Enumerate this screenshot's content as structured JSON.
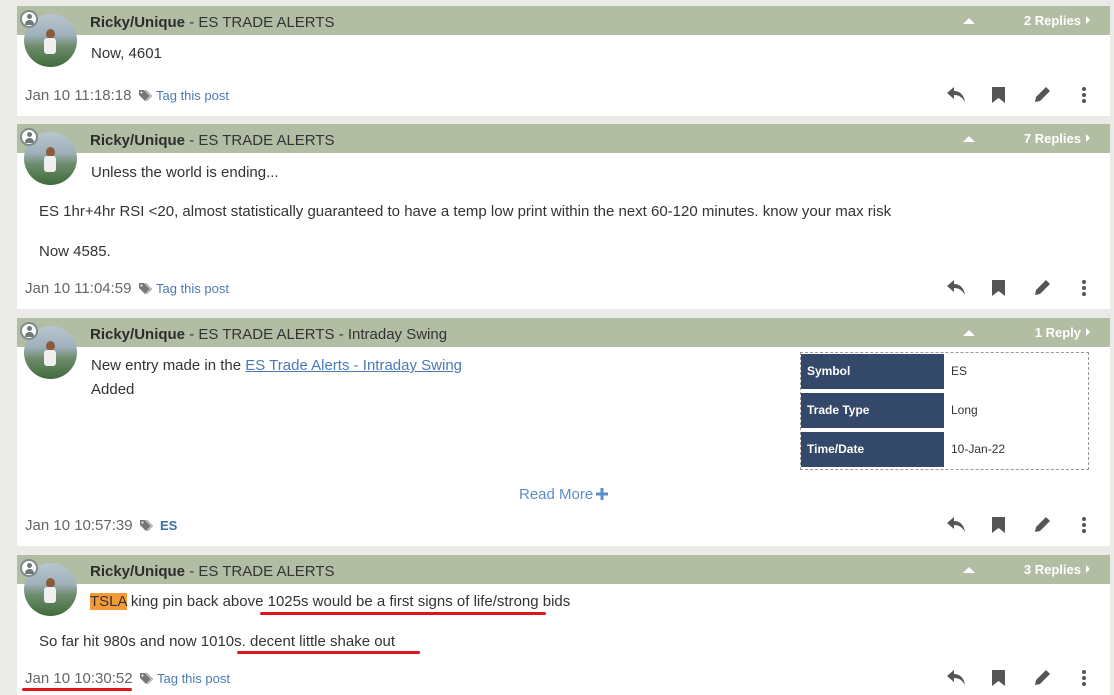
{
  "posts": [
    {
      "author": "Ricky/Unique",
      "channel": " - ES TRADE ALERTS",
      "replies": "2 Replies",
      "lines": [
        "Now, 4601"
      ],
      "time": "Jan 10 11:18:18",
      "tag": "Tag this post"
    },
    {
      "author": "Ricky/Unique",
      "channel": " - ES TRADE ALERTS",
      "replies": "7 Replies",
      "lines": [
        "Unless the world is ending...",
        "ES 1hr+4hr RSI <20, almost statistically guaranteed to have a temp low print within the next 60-120 minutes. know your max risk",
        "Now 4585."
      ],
      "time": "Jan 10 11:04:59",
      "tag": "Tag this post"
    },
    {
      "author": "Ricky/Unique",
      "channel": " - ES TRADE ALERTS - Intraday Swing",
      "replies": "1 Reply",
      "entry_prefix": "New entry made in the ",
      "entry_link": "ES Trade Alerts - Intraday Swing",
      "added": "Added",
      "trade_table": [
        {
          "key": "Symbol",
          "value": "ES"
        },
        {
          "key": "Trade Type",
          "value": "Long"
        },
        {
          "key": "Time/Date",
          "value": "10-Jan-22"
        }
      ],
      "read_more": "Read More",
      "time": "Jan 10 10:57:39",
      "tag": "ES"
    },
    {
      "author": "Ricky/Unique",
      "channel": " - ES TRADE ALERTS",
      "replies": "3 Replies",
      "ticker": "TSLA",
      "line1_rest": " king pin back above 1025s would be a first signs of life/strong bids",
      "line2": "So far hit 980s and now 1010s. decent little shake out",
      "time": "Jan 10 10:30:52",
      "tag": "Tag this post"
    }
  ],
  "icons": {
    "reply": "reply-icon",
    "bookmark": "bookmark-icon",
    "edit": "pencil-icon",
    "more": "more-vertical-icon",
    "tag": "tag-icon",
    "user": "user-icon",
    "collapse": "caret-up-icon"
  },
  "colors": {
    "header": "#b1bea4",
    "table_key": "#34486a",
    "highlight": "#f59a39",
    "annotation": "#e0141b",
    "link": "#4a7ab5"
  }
}
